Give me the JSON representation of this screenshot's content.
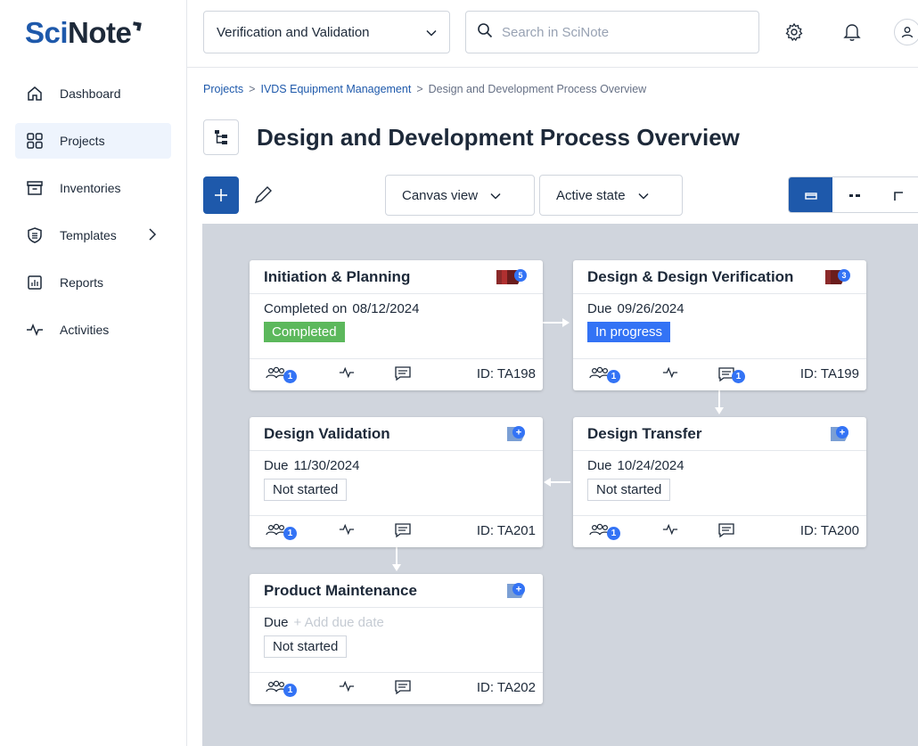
{
  "app": {
    "logo_sci": "Sci",
    "logo_note": "Note"
  },
  "sidebar": {
    "items": [
      {
        "label": "Dashboard",
        "icon": "home-icon"
      },
      {
        "label": "Projects",
        "icon": "grid-icon",
        "active": true
      },
      {
        "label": "Inventories",
        "icon": "archive-icon"
      },
      {
        "label": "Templates",
        "icon": "shield-icon",
        "has_submenu": true
      },
      {
        "label": "Reports",
        "icon": "report-icon"
      },
      {
        "label": "Activities",
        "icon": "pulse-icon"
      }
    ]
  },
  "topbar": {
    "team": "Verification and Validation",
    "search_placeholder": "Search in SciNote"
  },
  "breadcrumb": {
    "items": [
      "Projects",
      "IVDS Equipment Management",
      "Design and Development Process Overview"
    ]
  },
  "page": {
    "title": "Design and Development Process Overview"
  },
  "toolbar": {
    "view_select": "Canvas view",
    "state_select": "Active state"
  },
  "tasks": [
    {
      "title": "Initiation & Planning",
      "due_label": "Completed on",
      "due": "08/12/2024",
      "status": "Completed",
      "status_type": "completed",
      "members": "1",
      "comments": "",
      "id": "ID: TA198",
      "tag_count": "5",
      "tag_color": "#8b2a2a"
    },
    {
      "title": "Design & Design Verification",
      "due_label": "Due",
      "due": "09/26/2024",
      "status": "In progress",
      "status_type": "inprogress",
      "members": "1",
      "comments": "1",
      "id": "ID: TA199",
      "tag_count": "3",
      "tag_color": "#8b2a2a"
    },
    {
      "title": "Design Validation",
      "due_label": "Due",
      "due": "11/30/2024",
      "status": "Not started",
      "status_type": "notstarted",
      "members": "1",
      "comments": "",
      "id": "ID: TA201",
      "tag_count": "+",
      "tag_color": "#7b9fd4"
    },
    {
      "title": "Design Transfer",
      "due_label": "Due",
      "due": "10/24/2024",
      "status": "Not started",
      "status_type": "notstarted",
      "members": "1",
      "comments": "",
      "id": "ID: TA200",
      "tag_count": "+",
      "tag_color": "#7b9fd4"
    },
    {
      "title": "Product Maintenance",
      "due_label": "Due",
      "due": "+ Add due date",
      "status": "Not started",
      "status_type": "notstarted",
      "members": "1",
      "comments": "",
      "id": "ID: TA202",
      "tag_count": "+",
      "tag_color": "#7b9fd4",
      "due_placeholder": true
    }
  ],
  "colors": {
    "brand": "#1e59ab",
    "canvas": "#d0d5dd",
    "completed": "#5cb85c",
    "in_progress": "#3373f5"
  }
}
